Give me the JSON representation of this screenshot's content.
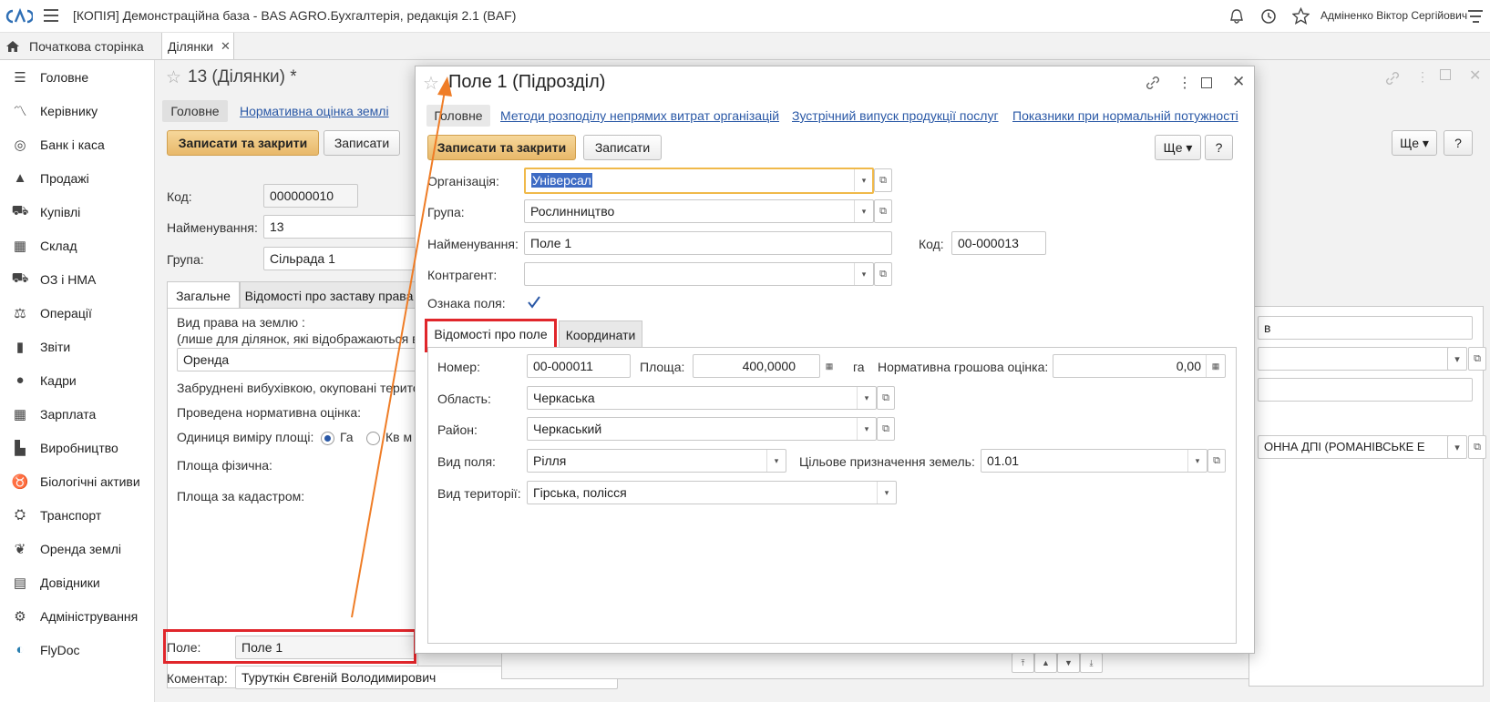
{
  "app": {
    "title": "[КОПІЯ] Демонстраційна база - BAS AGRO.Бухгалтерія, редакція 2.1  (BAF)",
    "user": "Адміненко Віктор Сергійович"
  },
  "tabs": {
    "home": "Початкова сторінка",
    "plots": "Ділянки"
  },
  "sidebar": {
    "items": [
      {
        "label": "Головне",
        "icon": "menu-icon"
      },
      {
        "label": "Керівнику",
        "icon": "chart-icon"
      },
      {
        "label": "Банк і каса",
        "icon": "coins-icon"
      },
      {
        "label": "Продажі",
        "icon": "bag-icon"
      },
      {
        "label": "Купівлі",
        "icon": "cart-icon"
      },
      {
        "label": "Склад",
        "icon": "warehouse-icon"
      },
      {
        "label": "ОЗ і НМА",
        "icon": "truck-icon"
      },
      {
        "label": "Операції",
        "icon": "operations-icon"
      },
      {
        "label": "Звіти",
        "icon": "reports-icon"
      },
      {
        "label": "Кадри",
        "icon": "person-icon"
      },
      {
        "label": "Зарплата",
        "icon": "calculator-icon"
      },
      {
        "label": "Виробництво",
        "icon": "factory-icon"
      },
      {
        "label": "Біологічні активи",
        "icon": "cow-icon"
      },
      {
        "label": "Транспорт",
        "icon": "tractor-icon"
      },
      {
        "label": "Оренда землі",
        "icon": "leaf-icon"
      },
      {
        "label": "Довідники",
        "icon": "books-icon"
      },
      {
        "label": "Адміністрування",
        "icon": "gear-icon"
      },
      {
        "label": "FlyDoc",
        "icon": "flydoc-icon"
      }
    ]
  },
  "bgform": {
    "title": "13 (Ділянки) *",
    "nav_main": "Головне",
    "nav_norm": "Нормативна оцінка землі",
    "save_close": "Записати та закрити",
    "save": "Записати",
    "more": "Ще",
    "help": "?",
    "code_label": "Код:",
    "code_value": "000000010",
    "name_label": "Найменування:",
    "name_value": "13",
    "group_label": "Група:",
    "group_value": "Сільрада 1",
    "tab_general": "Загальне",
    "tab_pledge": "Відомості про заставу права",
    "right_label": "Вид права на землю :",
    "right_note": "(лише для ділянок, які відображаються в",
    "right_value": "Оренда",
    "polluted_label": "Забруднені вибухівкою, окуповані терито",
    "norm_done_label": "Проведена нормативна оцінка:",
    "unit_label": "Одиниця виміру площі:",
    "unit_ha": "Га",
    "unit_km": "Кв м",
    "area_phys_label": "Площа фізична:",
    "area_cad_label": "Площа за кадастром:",
    "field_label": "Поле:",
    "field_value": "Поле 1",
    "comment_label": "Коментар:",
    "comment_value": "Туруткін Євгеній Володимирович",
    "right_fragment_1": "в",
    "right_fragment_2": "ОННА ДПІ (РОМАНІВСЬКЕ Е"
  },
  "modal": {
    "title": "Поле 1 (Підрозділ)",
    "nav": [
      "Головне",
      "Методи розподілу непрямих витрат організацій",
      "Зустрічний випуск продукції послуг",
      "Показники при нормальній потужності"
    ],
    "save_close": "Записати та закрити",
    "save": "Записати",
    "more": "Ще",
    "help": "?",
    "org_label": "Організація:",
    "org_value": "Універсал",
    "group_label": "Група:",
    "group_value": "Рослинництво",
    "name_label": "Найменування:",
    "name_value": "Поле 1",
    "code_label": "Код:",
    "code_value": "00-000013",
    "counterparty_label": "Контрагент:",
    "counterparty_value": "",
    "sign_label": "Ознака поля:",
    "sign_checked": true,
    "tab_field": "Відомості про поле",
    "tab_coords": "Координати",
    "number_label": "Номер:",
    "number_value": "00-000011",
    "area_label": "Площа:",
    "area_value": "400,0000",
    "area_unit": "га",
    "norm_label": "Нормативна грошова оцінка:",
    "norm_value": "0,00",
    "region_label": "Область:",
    "region_value": "Черкаська",
    "district_label": "Район:",
    "district_value": "Черкаський",
    "fieldtype_label": "Вид поля:",
    "fieldtype_value": "Рілля",
    "purpose_label": "Цільове призначення земель:",
    "purpose_value": "01.01",
    "territory_label": "Вид території:",
    "territory_value": "Гірська,  полісся"
  },
  "colors": {
    "accent": "#e8b86a",
    "highlight": "#e0262b",
    "arrow": "#ef7d27",
    "link": "#2a58a6"
  }
}
